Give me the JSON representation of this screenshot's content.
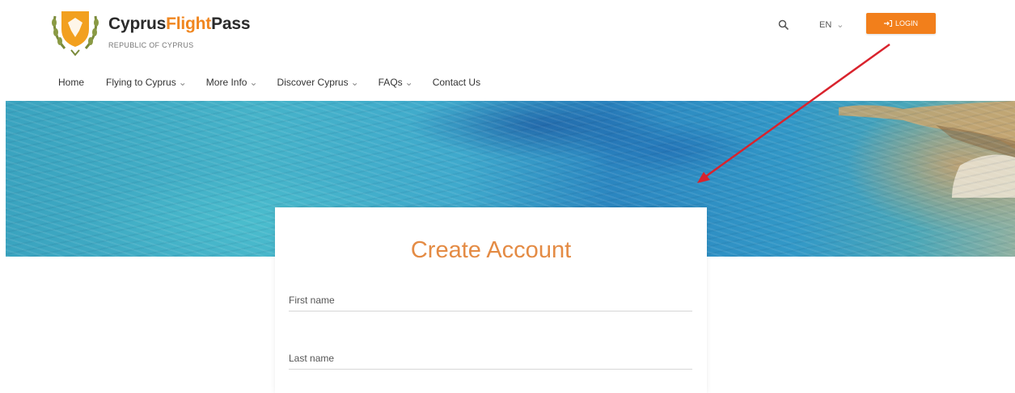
{
  "brand": {
    "part1": "Cyprus",
    "part2": "Flight",
    "part3": "Pass",
    "subtitle": "REPUBLIC OF CYPRUS",
    "accent_color": "#f0861f"
  },
  "header": {
    "search_icon": "search-icon",
    "language": "EN",
    "language_chevron": "⌄",
    "login_label": "LOGIN",
    "login_icon": "sign-in-icon",
    "login_color": "#f27f1b"
  },
  "nav": {
    "items": [
      {
        "label": "Home",
        "chevron": ""
      },
      {
        "label": "Flying to Cyprus",
        "chevron": "⌄"
      },
      {
        "label": "More Info",
        "chevron": "⌄"
      },
      {
        "label": "Discover Cyprus",
        "chevron": "⌄"
      },
      {
        "label": "FAQs",
        "chevron": "⌄"
      },
      {
        "label": "Contact Us",
        "chevron": ""
      }
    ]
  },
  "form": {
    "title": "Create Account",
    "title_color": "#e48b44",
    "first_name_placeholder": "First name",
    "last_name_placeholder": "Last name"
  },
  "annotation": {
    "arrow_color": "#d9232d"
  }
}
